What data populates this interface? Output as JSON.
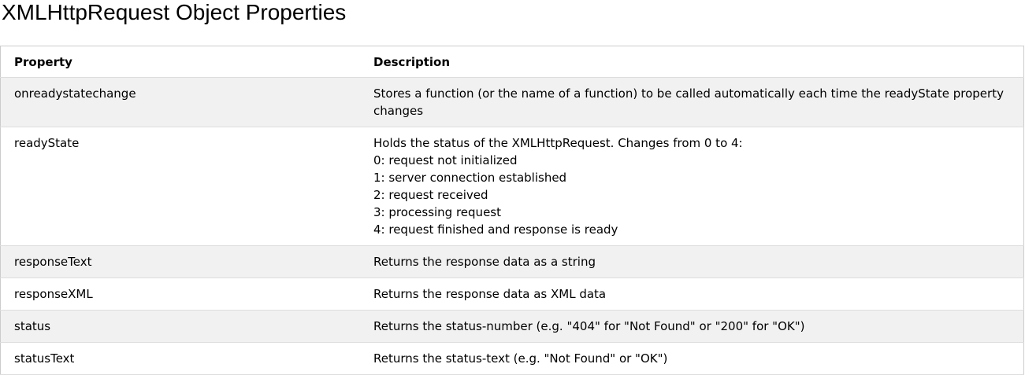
{
  "page": {
    "title": "XMLHttpRequest Object Properties"
  },
  "table": {
    "headers": {
      "property": "Property",
      "description": "Description"
    },
    "rows": [
      {
        "property": "onreadystatechange",
        "description": [
          "Stores a function (or the name of a function) to be called automatically each time the readyState property changes"
        ]
      },
      {
        "property": "readyState",
        "description": [
          "Holds the status of the XMLHttpRequest. Changes from 0 to 4:",
          "0: request not initialized",
          "1: server connection established",
          "2: request received",
          "3: processing request",
          "4: request finished and response is ready"
        ]
      },
      {
        "property": "responseText",
        "description": [
          "Returns the response data as a string"
        ]
      },
      {
        "property": "responseXML",
        "description": [
          "Returns the response data as XML data"
        ]
      },
      {
        "property": "status",
        "description": [
          "Returns the status-number (e.g. \"404\" for \"Not Found\" or \"200\" for \"OK\")"
        ]
      },
      {
        "property": "statusText",
        "description": [
          "Returns the status-text (e.g. \"Not Found\" or \"OK\")"
        ]
      }
    ]
  }
}
